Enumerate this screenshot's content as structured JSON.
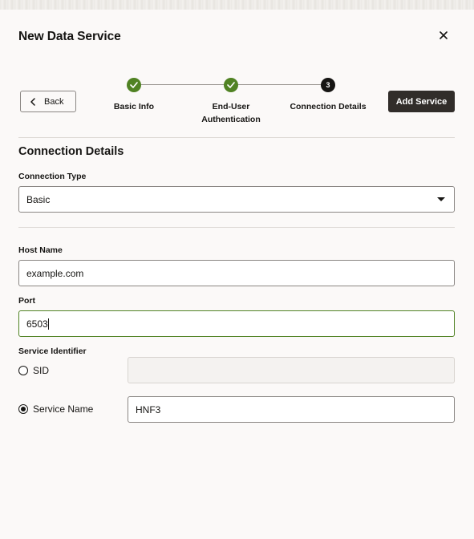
{
  "dialog": {
    "title": "New Data Service",
    "close_icon": "close-icon"
  },
  "toolbar": {
    "back_label": "Back",
    "add_label": "Add Service"
  },
  "steps": [
    {
      "label_line1": "Basic Info",
      "label_line2": "",
      "state": "done"
    },
    {
      "label_line1": "End-User",
      "label_line2": "Authentication",
      "state": "done"
    },
    {
      "label_line1": "Connection Details",
      "label_line2": "",
      "state": "current",
      "number": "3"
    }
  ],
  "section": {
    "title": "Connection Details"
  },
  "connection_type": {
    "label": "Connection Type",
    "value": "Basic"
  },
  "host": {
    "label": "Host Name",
    "value": "example.com"
  },
  "port": {
    "label": "Port",
    "value": "6503"
  },
  "service_identifier": {
    "label": "Service Identifier",
    "options": [
      {
        "label": "SID",
        "selected": false,
        "value": ""
      },
      {
        "label": "Service Name",
        "selected": true,
        "value": "HNF3"
      }
    ]
  },
  "colors": {
    "accent_green": "#508223",
    "primary_dark": "#312d2a"
  }
}
